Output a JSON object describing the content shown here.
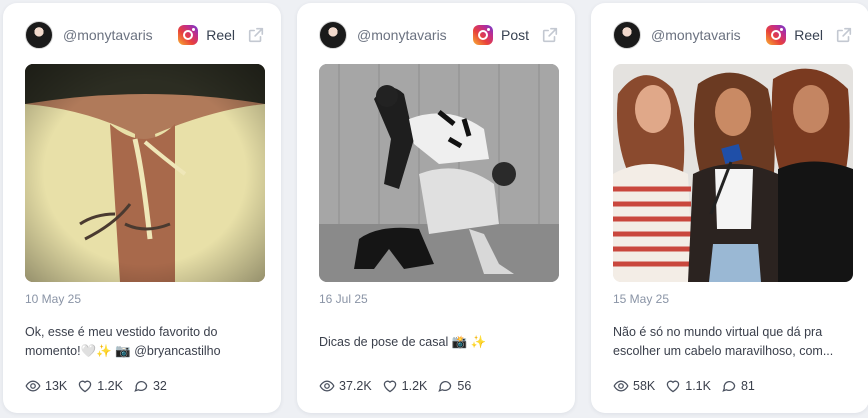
{
  "cards": [
    {
      "handle": "@monytavaris",
      "type": "Reel",
      "date": "10 May 25",
      "caption": "Ok, esse é meu vestido favorito do momento!🤍✨ 📷 @bryancastilho",
      "views": "13K",
      "likes": "1.2K",
      "comments": "32"
    },
    {
      "handle": "@monytavaris",
      "type": "Post",
      "date": "16 Jul 25",
      "caption": "Dicas de pose de casal 📸 ✨",
      "views": "37.2K",
      "likes": "1.2K",
      "comments": "56"
    },
    {
      "handle": "@monytavaris",
      "type": "Reel",
      "date": "15 May 25",
      "caption": "Não é só no mundo virtual que dá pra escolher um cabelo maravilhoso, com...",
      "views": "58K",
      "likes": "1.1K",
      "comments": "81"
    }
  ],
  "icons": {
    "platform": "instagram-icon",
    "open": "external-link-icon",
    "views": "eye-icon",
    "likes": "heart-icon",
    "comments": "comment-icon"
  },
  "colors": {
    "background": "#eef0f4",
    "card": "#ffffff",
    "muted": "#8a94a6"
  }
}
